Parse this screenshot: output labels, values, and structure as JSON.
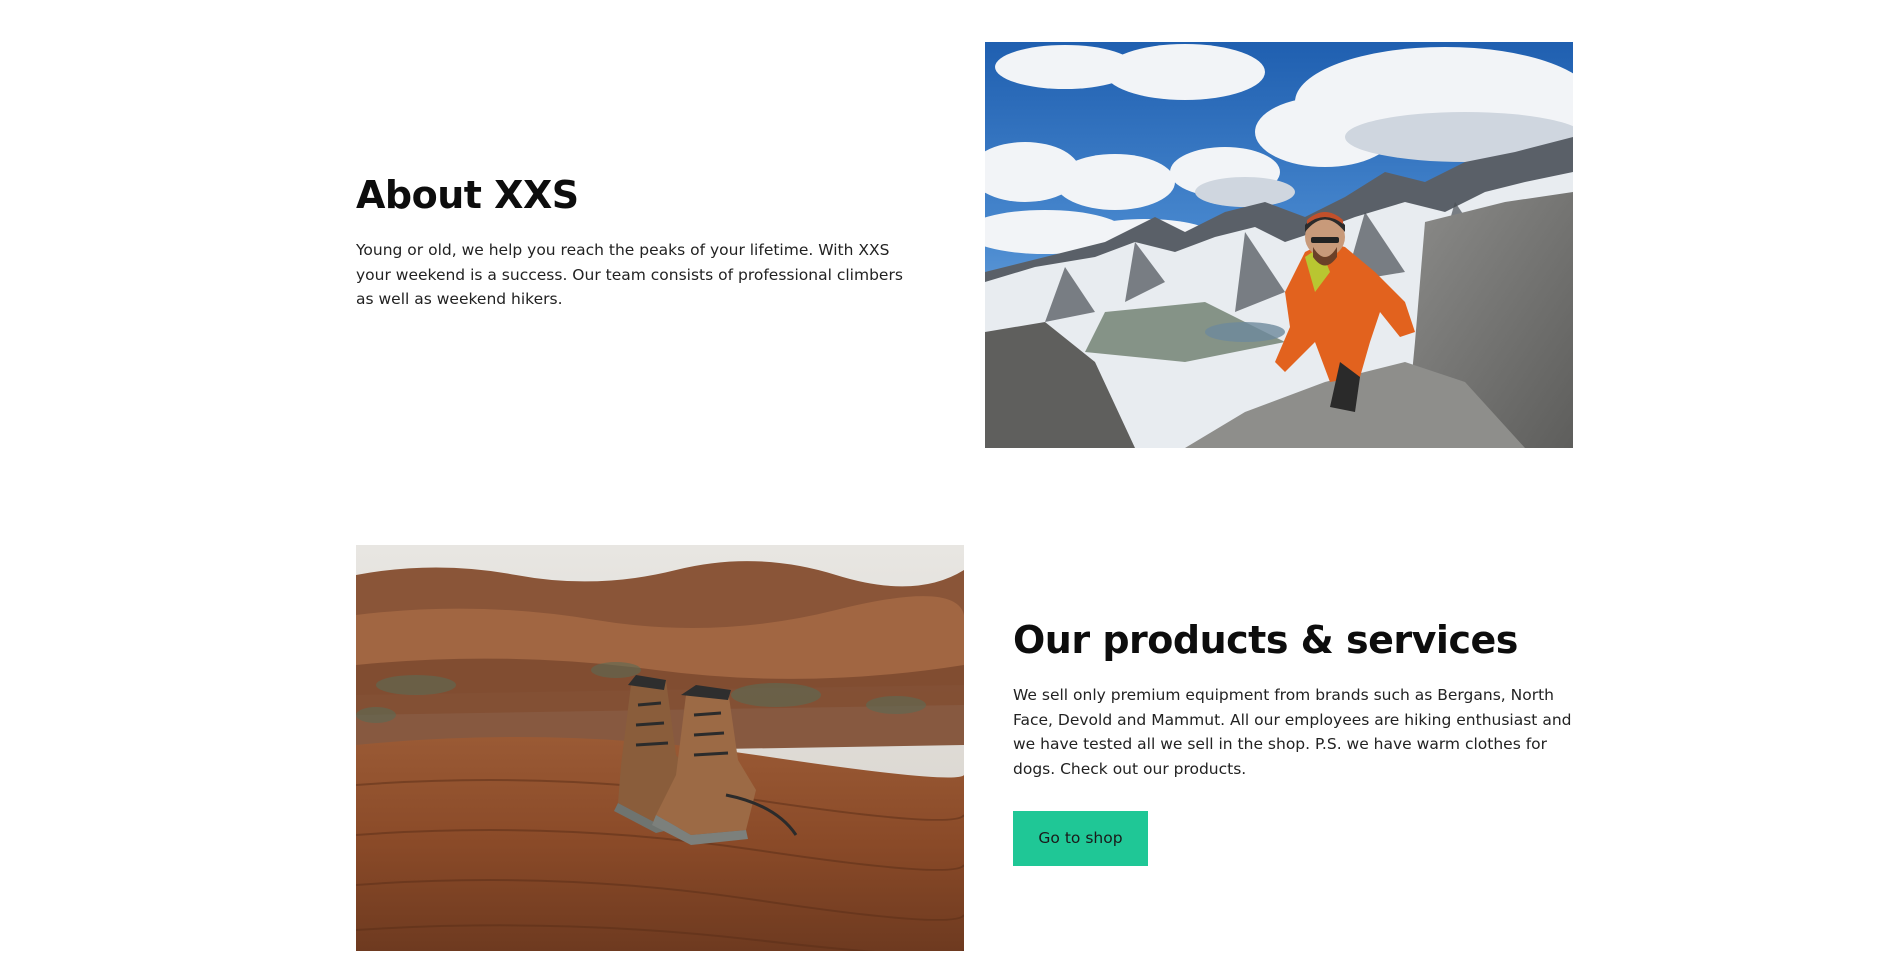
{
  "about": {
    "title": "About XXS",
    "body": "Young or old, we help you reach the peaks of your lifetime. With XXS your weekend is a success. Our team consists of professional climbers as well as weekend hikers."
  },
  "products": {
    "title": "Our products & services",
    "body": "We sell only premium equipment from brands such as Bergans, North Face, Devold and Mammut. All our employees are hiking enthusiast and we have tested all we sell in the shop. P.S. we have warm clothes for dogs. Check out our products.",
    "button_label": "Go to shop"
  },
  "colors": {
    "button": "#1fc796",
    "heading": "#0d0d0d"
  }
}
